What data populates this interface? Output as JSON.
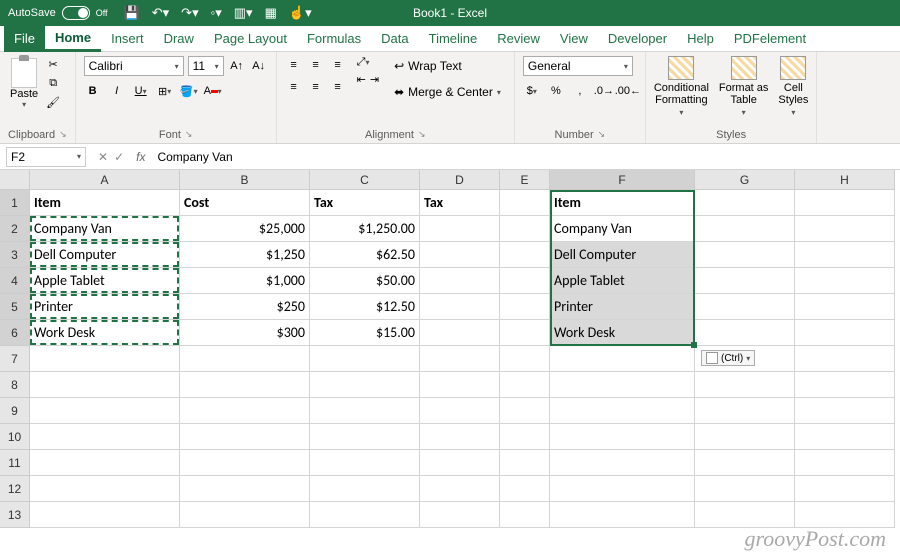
{
  "title": "Book1 - Excel",
  "autosave": {
    "label": "AutoSave",
    "state": "Off"
  },
  "tabs": [
    "File",
    "Home",
    "Insert",
    "Draw",
    "Page Layout",
    "Formulas",
    "Data",
    "Timeline",
    "Review",
    "View",
    "Developer",
    "Help",
    "PDFelement"
  ],
  "activeTab": "Home",
  "ribbon": {
    "paste": "Paste",
    "clipboard_group": "Clipboard",
    "font_group": "Font",
    "font_name": "Calibri",
    "font_size": "11",
    "wrap": "Wrap Text",
    "merge": "Merge & Center",
    "alignment_group": "Alignment",
    "number_format": "General",
    "number_group": "Number",
    "cond_fmt": "Conditional\nFormatting",
    "fmt_table": "Format as\nTable",
    "cell_styles": "Cell\nStyles",
    "styles_group": "Styles"
  },
  "fxbar": {
    "cellref": "F2",
    "value": "Company Van"
  },
  "columns": [
    "A",
    "B",
    "C",
    "D",
    "E",
    "F",
    "G",
    "H"
  ],
  "rows": [
    "1",
    "2",
    "3",
    "4",
    "5",
    "6",
    "7",
    "8",
    "9",
    "10",
    "11",
    "12",
    "13"
  ],
  "cells": {
    "A1": "Item",
    "B1": "Cost",
    "C1": "Tax",
    "D1": "Tax",
    "F1": "Item",
    "A2": "Company Van",
    "B2": "$25,000",
    "C2": "$1,250.00",
    "F2": "Company Van",
    "A3": "Dell Computer",
    "B3": "$1,250",
    "C3": "$62.50",
    "F3": "Dell Computer",
    "A4": "Apple Tablet",
    "B4": "$1,000",
    "C4": "$50.00",
    "F4": "Apple Tablet",
    "A5": "Printer",
    "B5": "$250",
    "C5": "$12.50",
    "F5": "Printer",
    "A6": "Work Desk",
    "B6": "$300",
    "C6": "$15.00",
    "F6": "Work Desk"
  },
  "paste_options_label": "(Ctrl)",
  "watermark": "groovyPost.com"
}
